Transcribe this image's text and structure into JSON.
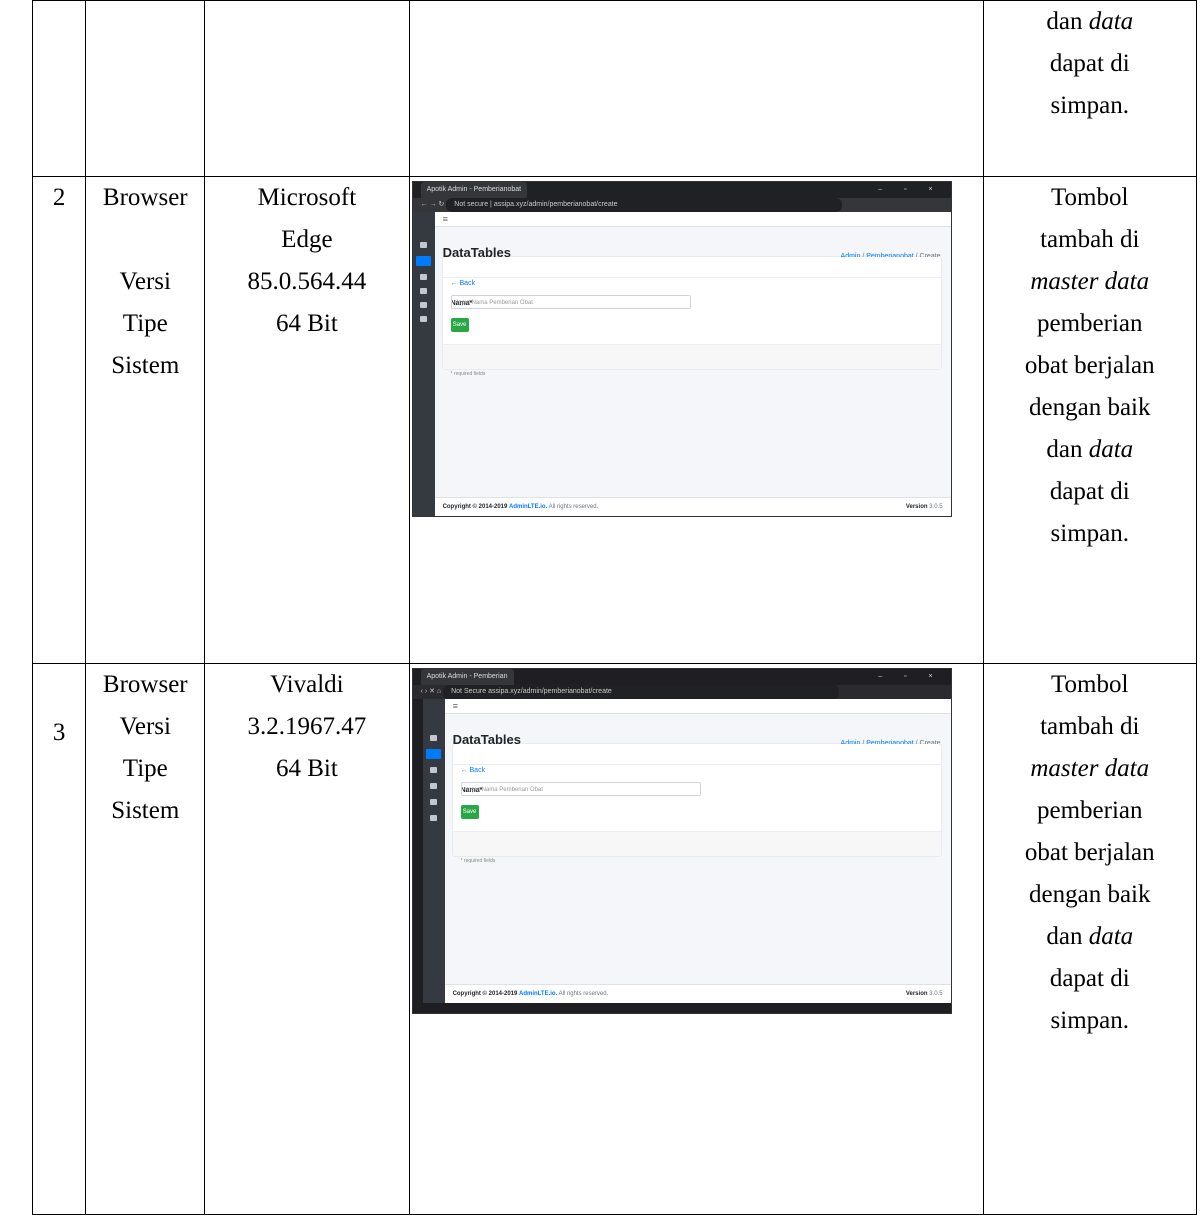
{
  "rows": [
    {
      "result_lines": [
        {
          "parts": [
            {
              "t": "dan ",
              "i": false
            },
            {
              "t": "data",
              "i": true
            }
          ]
        },
        {
          "parts": [
            {
              "t": "dapat di",
              "i": false
            }
          ]
        },
        {
          "parts": [
            {
              "t": "simpan.",
              "i": false
            }
          ]
        }
      ]
    },
    {
      "no": "2",
      "browser_label": "Browser",
      "browser_value_lines": [
        "Microsoft",
        "Edge"
      ],
      "version_label": "Versi",
      "version_value": "85.0.564.44",
      "type_label_lines": [
        "Tipe",
        "Sistem"
      ],
      "type_value": "64 Bit",
      "screenshot": {
        "tab_title": "Apotik Admin - Pemberianobat",
        "address": "Not secure | assipa.xyz/admin/pemberianobat/create",
        "page_title": "DataTables",
        "breadcrumb": [
          "Admin",
          "Pemberianobat",
          "Create"
        ],
        "back": "Back",
        "field_label": "Nama*",
        "placeholder": "Input Nama Pemberian Obat",
        "save": "Save",
        "required": "* required fields",
        "copyright_prefix": "Copyright © 2014-2019",
        "brand": "AdminLTE.io.",
        "rights": "All rights reserved.",
        "version_label": "Version",
        "version": "3.0.5"
      },
      "result_lines": [
        {
          "parts": [
            {
              "t": "Tombol",
              "i": false
            }
          ]
        },
        {
          "parts": [
            {
              "t": "tambah di",
              "i": false
            }
          ]
        },
        {
          "parts": [
            {
              "t": "master data",
              "i": true
            }
          ]
        },
        {
          "parts": [
            {
              "t": "pemberian",
              "i": false
            }
          ]
        },
        {
          "parts": [
            {
              "t": "obat berjalan",
              "i": false
            }
          ]
        },
        {
          "parts": [
            {
              "t": "dengan baik",
              "i": false
            }
          ]
        },
        {
          "parts": [
            {
              "t": "dan ",
              "i": false
            },
            {
              "t": "data",
              "i": true
            }
          ]
        },
        {
          "parts": [
            {
              "t": "dapat di",
              "i": false
            }
          ]
        },
        {
          "parts": [
            {
              "t": "simpan.",
              "i": false
            }
          ]
        }
      ]
    },
    {
      "no": "3",
      "browser_label": "Browser",
      "browser_value_lines": [
        "Vivaldi"
      ],
      "version_label": "Versi",
      "version_value": "3.2.1967.47",
      "type_label_lines": [
        "Tipe",
        "Sistem"
      ],
      "type_value": "64 Bit",
      "screenshot": {
        "tab_title": "Apotik Admin - Pemberian",
        "address": "Not Secure  assipa.xyz/admin/pemberianobat/create",
        "page_title": "DataTables",
        "breadcrumb": [
          "Admin",
          "Pemberianobat",
          "Create"
        ],
        "back": "Back",
        "field_label": "Nama*",
        "placeholder": "Input Nama Pemberian Obat",
        "save": "Save",
        "required": "* required fields",
        "copyright_prefix": "Copyright © 2014-2019",
        "brand": "AdminLTE.io.",
        "rights": "All rights reserved.",
        "version_label": "Version",
        "version": "3.0.5"
      },
      "result_lines": [
        {
          "parts": [
            {
              "t": "Tombol",
              "i": false
            }
          ]
        },
        {
          "parts": [
            {
              "t": "tambah di",
              "i": false
            }
          ]
        },
        {
          "parts": [
            {
              "t": "master data",
              "i": true
            }
          ]
        },
        {
          "parts": [
            {
              "t": "pemberian",
              "i": false
            }
          ]
        },
        {
          "parts": [
            {
              "t": "obat berjalan",
              "i": false
            }
          ]
        },
        {
          "parts": [
            {
              "t": "dengan baik",
              "i": false
            }
          ]
        },
        {
          "parts": [
            {
              "t": "dan ",
              "i": false
            },
            {
              "t": "data",
              "i": true
            }
          ]
        },
        {
          "parts": [
            {
              "t": "dapat di",
              "i": false
            }
          ]
        },
        {
          "parts": [
            {
              "t": "simpan.",
              "i": false
            }
          ]
        }
      ]
    }
  ]
}
